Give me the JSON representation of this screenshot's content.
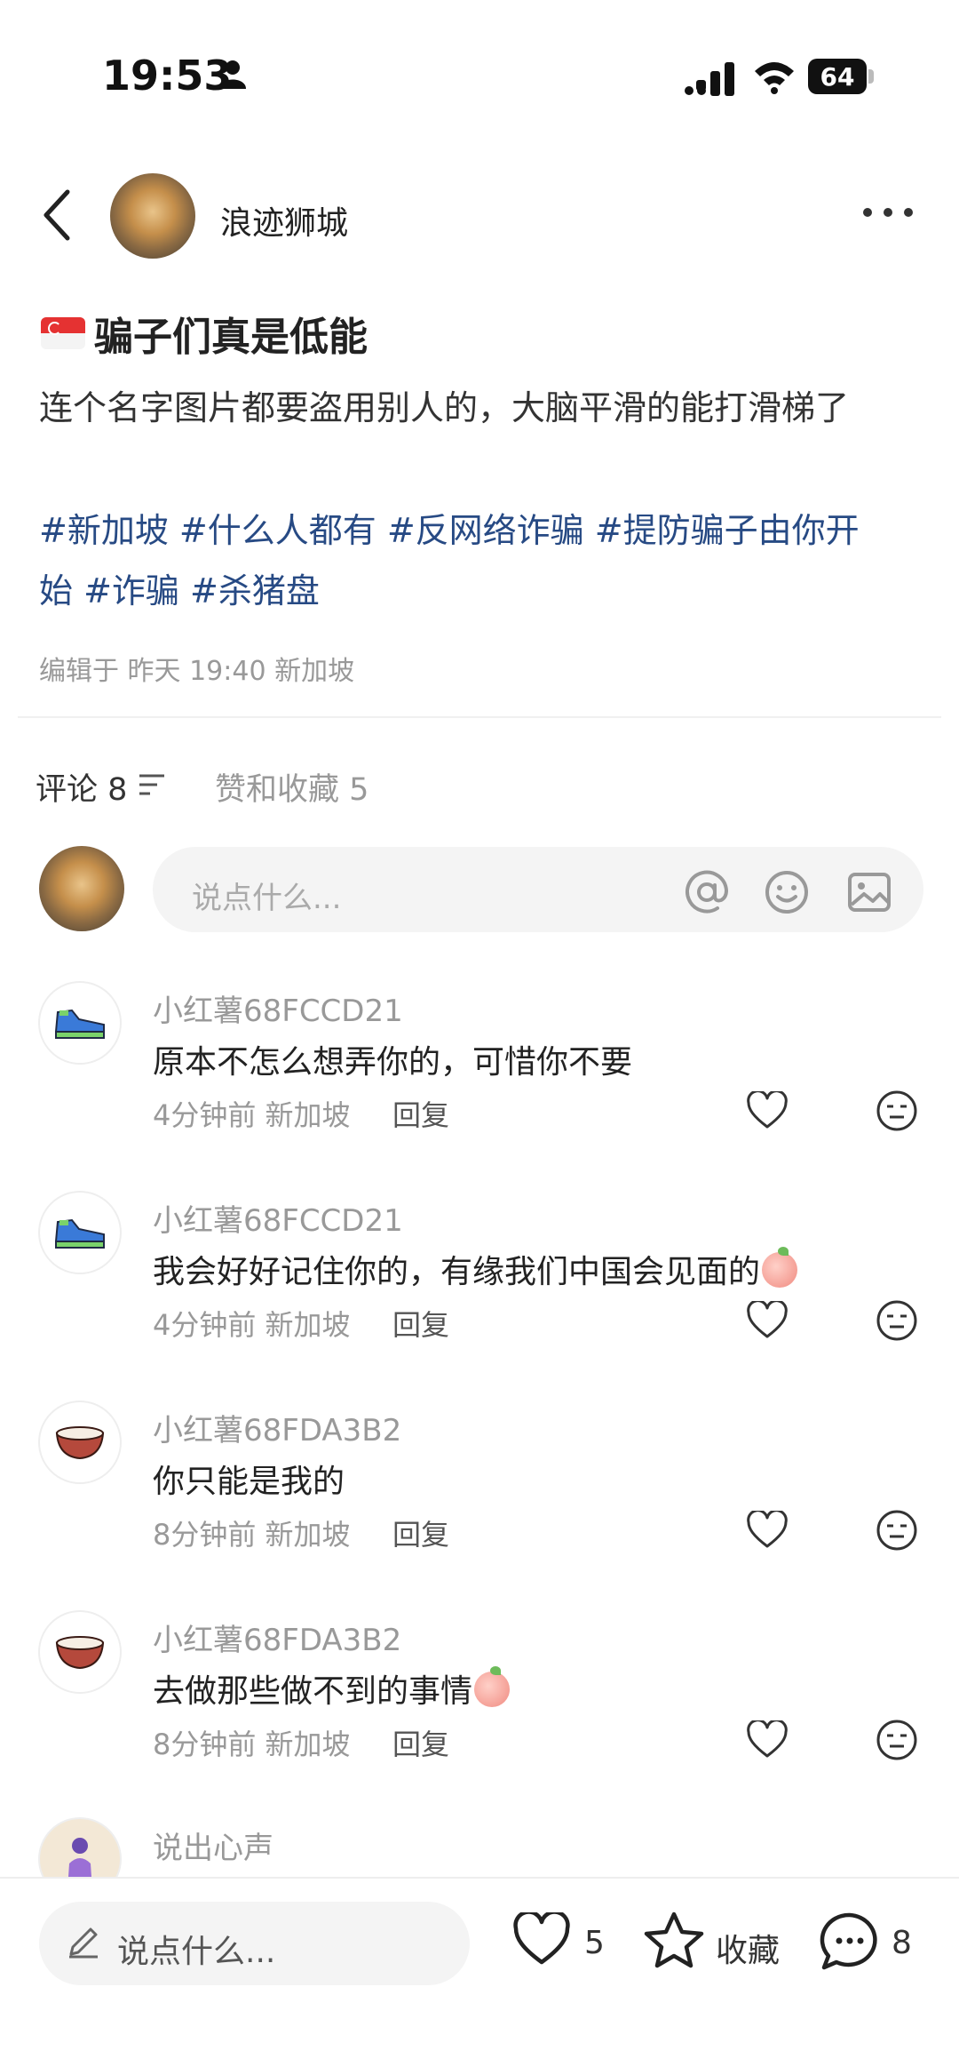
{
  "status": {
    "time": "19:53",
    "battery": "64"
  },
  "header": {
    "author": "浪迹狮城"
  },
  "post": {
    "title": "骗子们真是低能",
    "body": "连个名字图片都要盗用别人的，大脑平滑的能打滑梯了",
    "tags_line1": "#新加坡 #什么人都有 #反网络诈骗 #提防骗子由你开",
    "tags_line2": "始 #诈骗 #杀猪盘",
    "edited": "编辑于 昨天 19:40 新加坡"
  },
  "tabs": {
    "comments_label": "评论",
    "comments_count": "8",
    "likes_label": "赞和收藏",
    "likes_count": "5"
  },
  "input": {
    "placeholder": "说点什么..."
  },
  "comments": [
    {
      "name": "小红薯68FCCD21",
      "text": "原本不怎么想弄你的，可惜你不要",
      "time": "4分钟前",
      "location": "新加坡",
      "reply": "回复",
      "avatar": "sneaker-icon"
    },
    {
      "name": "小红薯68FCCD21",
      "text": "我会好好记住你的，有缘我们中国会见面的",
      "time": "4分钟前",
      "location": "新加坡",
      "reply": "回复",
      "avatar": "sneaker-icon"
    },
    {
      "name": "小红薯68FDA3B2",
      "text": "你只能是我的",
      "time": "8分钟前",
      "location": "新加坡",
      "reply": "回复",
      "avatar": "coconut-icon"
    },
    {
      "name": "小红薯68FDA3B2",
      "text": "去做那些做不到的事情",
      "time": "8分钟前",
      "location": "新加坡",
      "reply": "回复",
      "avatar": "coconut-icon"
    },
    {
      "name": "说出心声",
      "avatar": "girl-icon"
    }
  ],
  "bottom": {
    "placeholder": "说点什么...",
    "likes": "5",
    "favorite_label": "收藏",
    "comments": "8"
  }
}
